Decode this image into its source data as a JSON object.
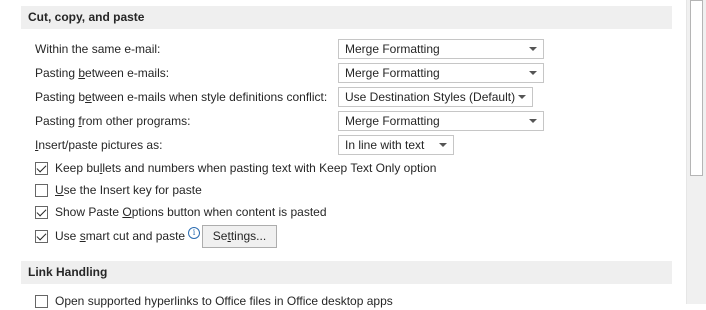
{
  "sections": {
    "cut_copy_paste": {
      "title": "Cut, copy, and paste"
    },
    "link_handling": {
      "title": "Link Handling"
    }
  },
  "paste_rows": [
    {
      "label_pre": "Within the same e-mail:",
      "label_u": "",
      "label_post": "",
      "value": "Merge Formatting"
    },
    {
      "label_pre": "Pasting ",
      "label_u": "b",
      "label_post": "etween e-mails:",
      "value": "Merge Formatting"
    },
    {
      "label_pre": "Pasting b",
      "label_u": "e",
      "label_post": "tween e-mails when style definitions conflict:",
      "value": "Use Destination Styles (Default)"
    },
    {
      "label_pre": "Pasting ",
      "label_u": "f",
      "label_post": "rom other programs:",
      "value": "Merge Formatting"
    },
    {
      "label_pre": "",
      "label_u": "I",
      "label_post": "nsert/paste pictures as:",
      "value": "In line with text"
    }
  ],
  "checks": [
    {
      "pre": "Keep bu",
      "u": "l",
      "post": "lets and numbers when pasting text with Keep Text Only option",
      "checked": true
    },
    {
      "pre": "",
      "u": "U",
      "post": "se the Insert key for paste",
      "checked": false
    },
    {
      "pre": "Show Paste ",
      "u": "O",
      "post": "ptions button when content is pasted",
      "checked": true
    },
    {
      "pre": "Use ",
      "u": "s",
      "post": "mart cut and paste",
      "checked": true
    }
  ],
  "info_glyph": "i",
  "settings_button": {
    "pre": "Se",
    "u": "t",
    "post": "tings..."
  },
  "link_check": {
    "label": "Open supported hyperlinks to Office files in Office desktop apps",
    "checked": false
  },
  "icons": {
    "info": "info-icon",
    "dropdown": "chevron-down-icon"
  }
}
